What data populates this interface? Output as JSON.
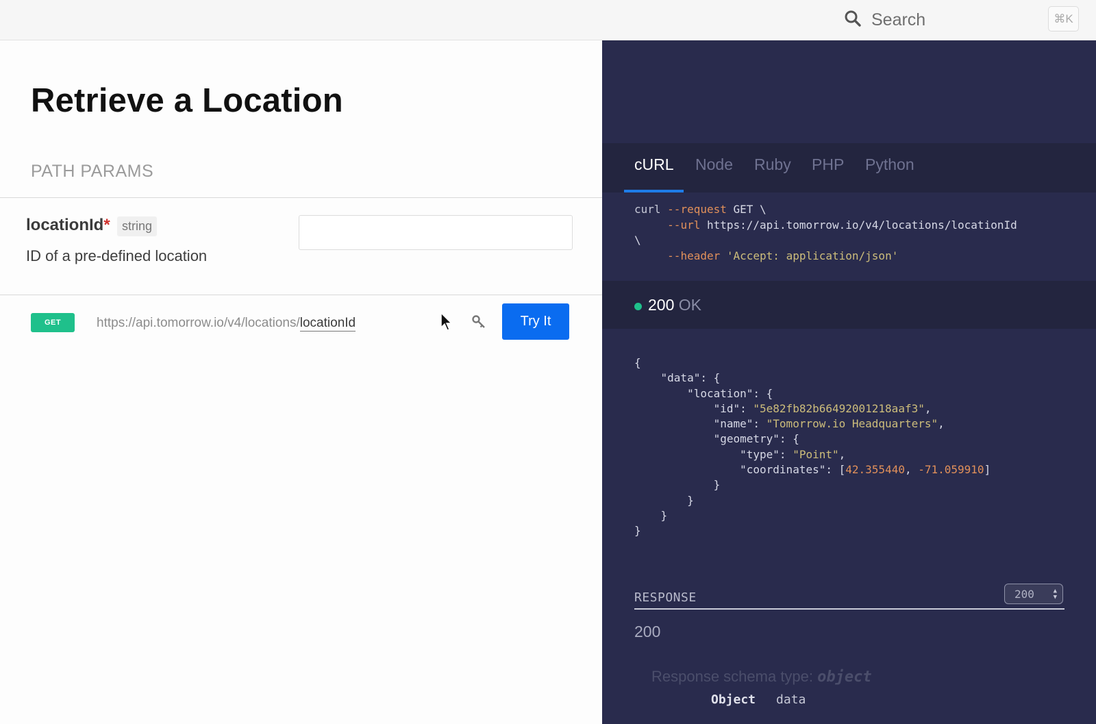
{
  "topbar": {
    "search_label": "Search",
    "shortcut": "⌘K"
  },
  "left": {
    "title": "Retrieve a Location",
    "section_label": "PATH PARAMS",
    "param": {
      "name": "locationId",
      "required_mark": "*",
      "type": "string",
      "description": "ID of a pre-defined location",
      "input_value": ""
    },
    "request": {
      "method": "GET",
      "url_prefix": "https://api.tomorrow.io/v4/locations/",
      "url_param": "locationId",
      "try_label": "Try It"
    }
  },
  "right": {
    "tabs": [
      {
        "label": "cURL",
        "active": true
      },
      {
        "label": "Node",
        "active": false
      },
      {
        "label": "Ruby",
        "active": false
      },
      {
        "label": "PHP",
        "active": false
      },
      {
        "label": "Python",
        "active": false
      }
    ],
    "curl": {
      "cmd": "curl",
      "request_flag": "--request",
      "method": "GET",
      "url_flag": "--url",
      "url": "https://api.tomorrow.io/v4/locations/locationId",
      "header_flag": "--header",
      "header_value": "'Accept: application/json'"
    },
    "status": {
      "code": "200",
      "text": "OK"
    },
    "response_json": {
      "data_key": "\"data\"",
      "location_key": "\"location\"",
      "id_key": "\"id\"",
      "id_value": "\"5e82fb82b66492001218aaf3\"",
      "name_key": "\"name\"",
      "name_value": "\"Tomorrow.io Headquarters\"",
      "geometry_key": "\"geometry\"",
      "type_key": "\"type\"",
      "type_value": "\"Point\"",
      "coords_key": "\"coordinates\"",
      "lat": "42.355440",
      "lon": "-71.059910"
    },
    "response_section": {
      "label": "RESPONSE",
      "selected_code": "200",
      "code": "200",
      "schema_prefix": "Response schema type:",
      "schema_type": "object",
      "row_type": "Object",
      "row_name": "data"
    }
  },
  "colors": {
    "accent_blue": "#0a6cf0",
    "get_green": "#1fc08b",
    "dark_panel": "#292b4d",
    "required_red": "#d0312d"
  },
  "icons": [
    "search-icon",
    "key-icon",
    "mouse-pointer-icon",
    "status-dot-icon"
  ]
}
